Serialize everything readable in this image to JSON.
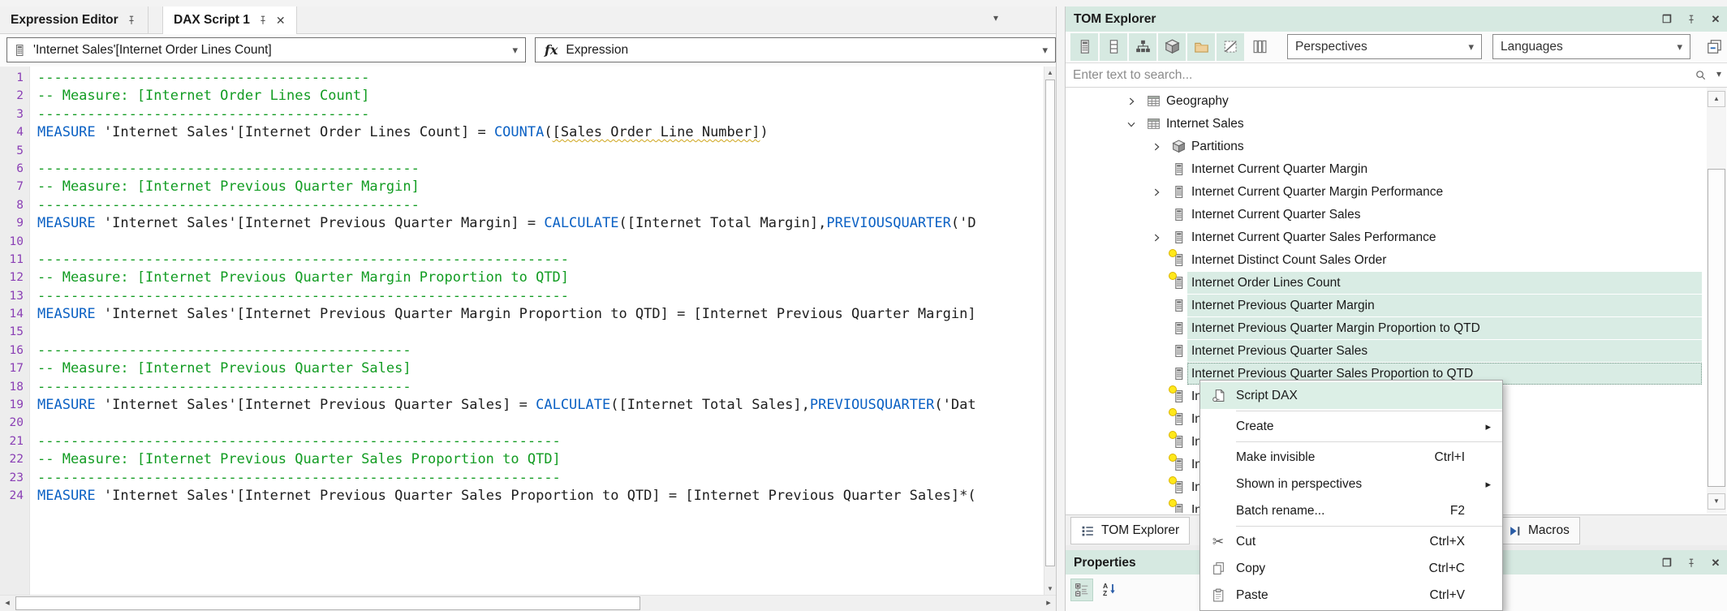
{
  "colors": {
    "accent_teal": "#d6e9e1",
    "selection_teal": "#d9ece4",
    "keyword_blue": "#0b61c4",
    "comment_green": "#129c22",
    "line_number_purple": "#8a3fb5",
    "badge_yellow": "#ffe81a"
  },
  "editor": {
    "tabs": [
      {
        "label": "Expression Editor"
      },
      {
        "label": "DAX Script 1"
      }
    ],
    "object_selector": "'Internet Sales'[Internet Order Lines Count]",
    "fx_glyph": "fx",
    "expression_selector": "Expression",
    "code_lines": [
      [
        [
          "c",
          "----------------------------------------"
        ]
      ],
      [
        [
          "c",
          "-- Measure: [Internet Order Lines Count]"
        ]
      ],
      [
        [
          "c",
          "----------------------------------------"
        ]
      ],
      [
        [
          "k",
          "MEASURE"
        ],
        [
          "p",
          " 'Internet Sales'[Internet Order Lines Count] = "
        ],
        [
          "k",
          "COUNTA"
        ],
        [
          "p",
          "("
        ],
        [
          "e",
          "[Sales Order Line Number]"
        ],
        [
          "p",
          ")"
        ]
      ],
      [],
      [
        [
          "c",
          "----------------------------------------------"
        ]
      ],
      [
        [
          "c",
          "-- Measure: [Internet Previous Quarter Margin]"
        ]
      ],
      [
        [
          "c",
          "----------------------------------------------"
        ]
      ],
      [
        [
          "k",
          "MEASURE"
        ],
        [
          "p",
          " 'Internet Sales'[Internet Previous Quarter Margin] = "
        ],
        [
          "k",
          "CALCULATE"
        ],
        [
          "p",
          "([Internet Total Margin],"
        ],
        [
          "k",
          "PREVIOUSQUARTER"
        ],
        [
          "p",
          "('D"
        ]
      ],
      [],
      [
        [
          "c",
          "----------------------------------------------------------------"
        ]
      ],
      [
        [
          "c",
          "-- Measure: [Internet Previous Quarter Margin Proportion to QTD]"
        ]
      ],
      [
        [
          "c",
          "----------------------------------------------------------------"
        ]
      ],
      [
        [
          "k",
          "MEASURE"
        ],
        [
          "p",
          " 'Internet Sales'[Internet Previous Quarter Margin Proportion to QTD] = [Internet Previous Quarter Margin]"
        ]
      ],
      [],
      [
        [
          "c",
          "---------------------------------------------"
        ]
      ],
      [
        [
          "c",
          "-- Measure: [Internet Previous Quarter Sales]"
        ]
      ],
      [
        [
          "c",
          "---------------------------------------------"
        ]
      ],
      [
        [
          "k",
          "MEASURE"
        ],
        [
          "p",
          " 'Internet Sales'[Internet Previous Quarter Sales] = "
        ],
        [
          "k",
          "CALCULATE"
        ],
        [
          "p",
          "([Internet Total Sales],"
        ],
        [
          "k",
          "PREVIOUSQUARTER"
        ],
        [
          "p",
          "('Dat"
        ]
      ],
      [],
      [
        [
          "c",
          "---------------------------------------------------------------"
        ]
      ],
      [
        [
          "c",
          "-- Measure: [Internet Previous Quarter Sales Proportion to QTD]"
        ]
      ],
      [
        [
          "c",
          "---------------------------------------------------------------"
        ]
      ],
      [
        [
          "k",
          "MEASURE"
        ],
        [
          "p",
          " 'Internet Sales'[Internet Previous Quarter Sales Proportion to QTD] = [Internet Previous Quarter Sales]*("
        ]
      ]
    ]
  },
  "tom": {
    "title": "TOM Explorer",
    "toolbar": {
      "toggles": [
        {
          "icon": "measure",
          "on": true
        },
        {
          "icon": "column",
          "on": true
        },
        {
          "icon": "hierarchy",
          "on": true
        },
        {
          "icon": "partition",
          "on": true
        },
        {
          "icon": "folder",
          "on": true
        },
        {
          "icon": "hidden-items",
          "on": true
        },
        {
          "icon": "columns-view",
          "on": false
        }
      ],
      "perspectives_label": "Perspectives",
      "languages_label": "Languages"
    },
    "search_placeholder": "Enter text to search...",
    "tree_items": [
      {
        "level": 1,
        "chevron": "collapsed",
        "icon": "table",
        "label": "Geography"
      },
      {
        "level": 1,
        "chevron": "expanded",
        "icon": "table",
        "label": "Internet Sales"
      },
      {
        "level": 2,
        "chevron": "collapsed",
        "icon": "partition",
        "label": "Partitions"
      },
      {
        "level": 2,
        "icon": "measure",
        "label": "Internet Current Quarter Margin"
      },
      {
        "level": 2,
        "chevron": "collapsed",
        "icon": "measure",
        "label": "Internet Current Quarter Margin Performance"
      },
      {
        "level": 2,
        "icon": "measure",
        "label": "Internet Current Quarter Sales"
      },
      {
        "level": 2,
        "chevron": "collapsed",
        "icon": "measure",
        "label": "Internet Current Quarter Sales Performance"
      },
      {
        "level": 2,
        "icon": "measure",
        "badge": true,
        "label": "Internet Distinct Count Sales Order"
      },
      {
        "level": 2,
        "icon": "measure",
        "badge": true,
        "label": "Internet Order Lines Count",
        "selected": true
      },
      {
        "level": 2,
        "icon": "measure",
        "label": "Internet Previous Quarter Margin",
        "selected": true
      },
      {
        "level": 2,
        "icon": "measure",
        "label": "Internet Previous Quarter Margin Proportion to QTD",
        "selected": true
      },
      {
        "level": 2,
        "icon": "measure",
        "label": "Internet Previous Quarter Sales",
        "selected": true
      },
      {
        "level": 2,
        "icon": "measure",
        "label": "Internet Previous Quarter Sales Proportion to QTD",
        "selected": true,
        "focused": true
      },
      {
        "level": 2,
        "icon": "measure",
        "badge": true,
        "label": "Int",
        "truncated": true
      },
      {
        "level": 2,
        "icon": "measure",
        "badge": true,
        "label": "Int",
        "truncated": true
      },
      {
        "level": 2,
        "icon": "measure",
        "badge": true,
        "label": "Int",
        "truncated": true
      },
      {
        "level": 2,
        "icon": "measure",
        "badge": true,
        "label": "Int",
        "truncated": true
      },
      {
        "level": 2,
        "icon": "measure",
        "badge": true,
        "label": "Int",
        "truncated": true
      },
      {
        "level": 2,
        "icon": "measure",
        "badge": true,
        "label": "Int",
        "truncated": true
      }
    ],
    "bottom_tabs": [
      {
        "icon": "tom-tab",
        "label": "TOM Explorer",
        "active": true
      },
      {
        "icon": "macros",
        "label": "Macros",
        "active": false
      }
    ]
  },
  "context_menu": {
    "items": [
      {
        "label": "Script DAX",
        "icon": "script",
        "highlighted": true
      },
      {
        "separator": true
      },
      {
        "label": "Create",
        "submenu": true
      },
      {
        "separator": true
      },
      {
        "label": "Make invisible",
        "shortcut": "Ctrl+I"
      },
      {
        "label": "Shown in perspectives",
        "submenu": true
      },
      {
        "label": "Batch rename...",
        "shortcut": "F2"
      },
      {
        "separator": true
      },
      {
        "label": "Cut",
        "icon": "cut",
        "shortcut": "Ctrl+X"
      },
      {
        "label": "Copy",
        "icon": "copy",
        "shortcut": "Ctrl+C"
      },
      {
        "label": "Paste",
        "icon": "paste",
        "shortcut": "Ctrl+V"
      }
    ]
  },
  "properties": {
    "title": "Properties"
  }
}
